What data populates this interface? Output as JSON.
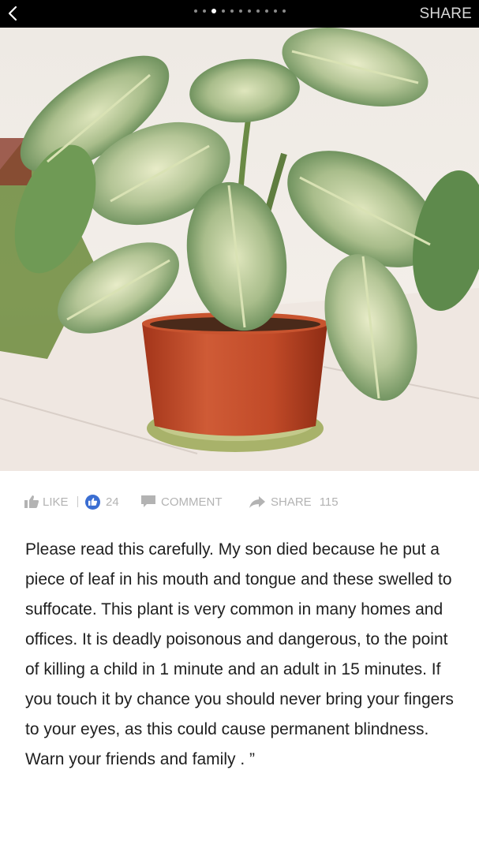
{
  "topbar": {
    "share_label": "SHARE",
    "slide_count": 11,
    "active_slide": 3
  },
  "photo": {
    "description_icon": "image-potted-plant"
  },
  "actions": {
    "like_label": "LIKE",
    "like_count": "24",
    "comment_label": "COMMENT",
    "share_label": "SHARE",
    "share_count": "115"
  },
  "caption": {
    "text": "Please read this carefully. My son died because he put a piece of leaf in his mouth and tongue and these swelled to suffocate. This plant is very common in many homes and offices. It is deadly poisonous and dangerous, to the point of killing a child in 1 minute and an adult in 15 minutes. If you touch it by chance you should never bring your fingers to your eyes, as this could cause permanent blindness. Warn your friends and family . ”"
  },
  "colors": {
    "topbar_bg": "#000000",
    "action_text": "#b3b3b3",
    "like_badge": "#3b6ed2",
    "caption_text": "#1f1f1f"
  }
}
